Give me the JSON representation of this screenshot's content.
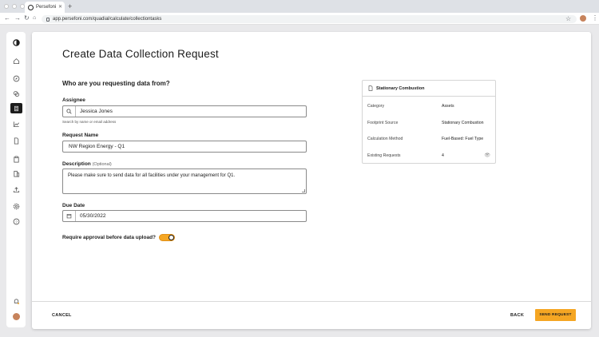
{
  "browser": {
    "tab_title": "Persefoni",
    "url": "app.persefoni.com/quadial/calculate/collectiontasks"
  },
  "page": {
    "title": "Create Data Collection Request",
    "question": "Who are you requesting data from?"
  },
  "form": {
    "assignee_label": "Assignee",
    "assignee_value": "Jessica Jones",
    "assignee_helper": "Search by name or email address",
    "request_name_label": "Request Name",
    "request_name_value": "NW Region Energy - Q1",
    "description_label": "Description",
    "description_optional": "(Optional)",
    "description_value": "Please make sure to send data for all facilities under your management for Q1.",
    "due_date_label": "Due Date",
    "due_date_value": "05/30/2022",
    "approval_label": "Require approval before data upload?",
    "approval_on": true
  },
  "card": {
    "title": "Stationary Combustion",
    "rows": [
      {
        "key": "Category",
        "value": "Assets"
      },
      {
        "key": "Footprint Source",
        "value": "Stationary Combustion"
      },
      {
        "key": "Calculation Method",
        "value": "Fuel-Based: Fuel Type"
      },
      {
        "key": "Existing Requests",
        "value": "4"
      }
    ]
  },
  "footer": {
    "cancel_label": "CANCEL",
    "back_label": "BACK",
    "send_label": "SEND REQUEST"
  },
  "colors": {
    "accent": "#f5a623",
    "nav_active": "#1c1c1c"
  }
}
